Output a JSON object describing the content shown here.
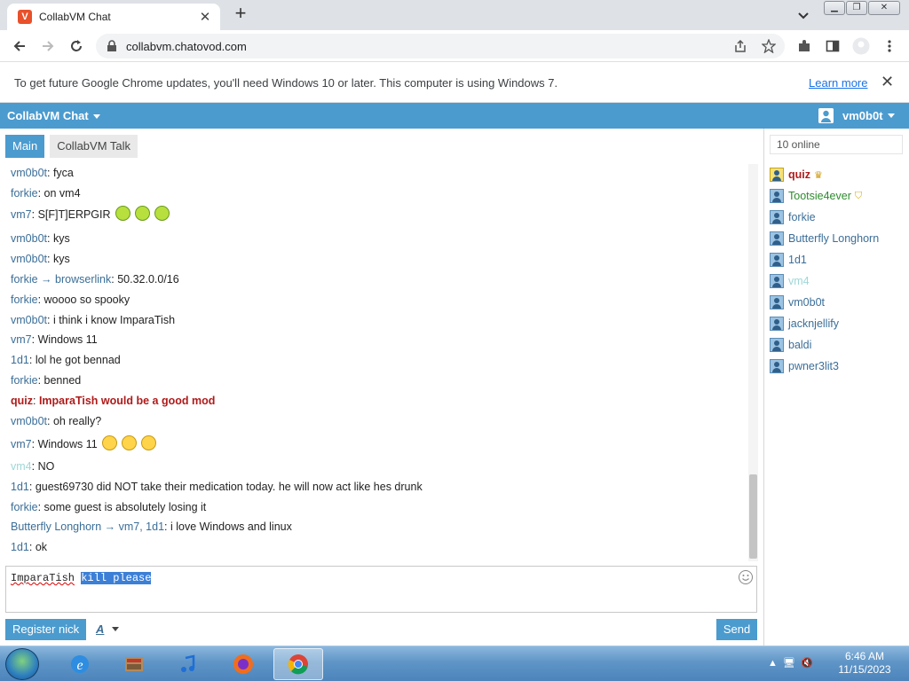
{
  "browser": {
    "tab_title": "CollabVM Chat",
    "favicon_letter": "V",
    "url": "collabvm.chatovod.com"
  },
  "infobar": {
    "message": "To get future Google Chrome updates, you'll need Windows 10 or later. This computer is using Windows 7.",
    "link": "Learn more"
  },
  "app": {
    "title": "CollabVM Chat",
    "current_user": "vm0b0t",
    "tabs": [
      "Main",
      "CollabVM Talk"
    ],
    "accent_color": "#4b9bcf"
  },
  "messages": [
    {
      "nick": "vm0b0t",
      "text": "fyca"
    },
    {
      "nick": "forkie",
      "text": "on vm4"
    },
    {
      "nick": "vm7",
      "text": "S[F]T]ERPGIR",
      "emojis": [
        "puke",
        "puke",
        "puke"
      ]
    },
    {
      "nick": "vm0b0t",
      "text": "kys"
    },
    {
      "nick": "vm0b0t",
      "text": "kys"
    },
    {
      "nick": "forkie",
      "to": "browserlink",
      "text": "50.32.0.0/16"
    },
    {
      "nick": "forkie",
      "text": "woooo so spooky"
    },
    {
      "nick": "vm0b0t",
      "text": "i think i know ImparaTish"
    },
    {
      "nick": "vm7",
      "text": "Windows 11"
    },
    {
      "nick": "1d1",
      "text": "lol he got bennad"
    },
    {
      "nick": "forkie",
      "text": "benned"
    },
    {
      "nick": "quiz",
      "text": "ImparaTish would be a good mod",
      "role": "admin"
    },
    {
      "nick": "vm0b0t",
      "text": "oh really?"
    },
    {
      "nick": "vm7",
      "text": "Windows 11",
      "emojis": [
        "smile",
        "smile",
        "smile"
      ]
    },
    {
      "nick": "vm4",
      "text": "NO",
      "role": "faded"
    },
    {
      "nick": "1d1",
      "text": "guest69730 did NOT take their medication today. he will now act like hes drunk"
    },
    {
      "nick": "forkie",
      "text": "some guest is absolutely losing it"
    },
    {
      "nick": "Butterfly Longhorn",
      "to": "vm7, 1d1",
      "text": "i love Windows and linux"
    },
    {
      "nick": "1d1",
      "text": "ok"
    }
  ],
  "compose": {
    "prefix": "ImparaTish",
    "selected": "kill please"
  },
  "buttons": {
    "register": "Register nick",
    "format": "A",
    "send": "Send"
  },
  "sidebar": {
    "online_count": "10 online",
    "users": [
      {
        "name": "quiz",
        "role": "admin",
        "badge": "crown"
      },
      {
        "name": "Tootsie4ever",
        "role": "mod",
        "badge": "shield"
      },
      {
        "name": "forkie",
        "role": "user"
      },
      {
        "name": "Butterfly Longhorn",
        "role": "user"
      },
      {
        "name": "1d1",
        "role": "user"
      },
      {
        "name": "vm4",
        "role": "faded"
      },
      {
        "name": "vm0b0t",
        "role": "user"
      },
      {
        "name": "jacknjellify",
        "role": "user"
      },
      {
        "name": "baldi",
        "role": "user"
      },
      {
        "name": "pwner3lit3",
        "role": "user"
      }
    ]
  },
  "taskbar": {
    "apps": [
      "internet-explorer",
      "file-manager",
      "itunes",
      "firefox",
      "chrome"
    ],
    "active_app": "chrome",
    "time": "6:46 AM",
    "date": "11/15/2023"
  }
}
